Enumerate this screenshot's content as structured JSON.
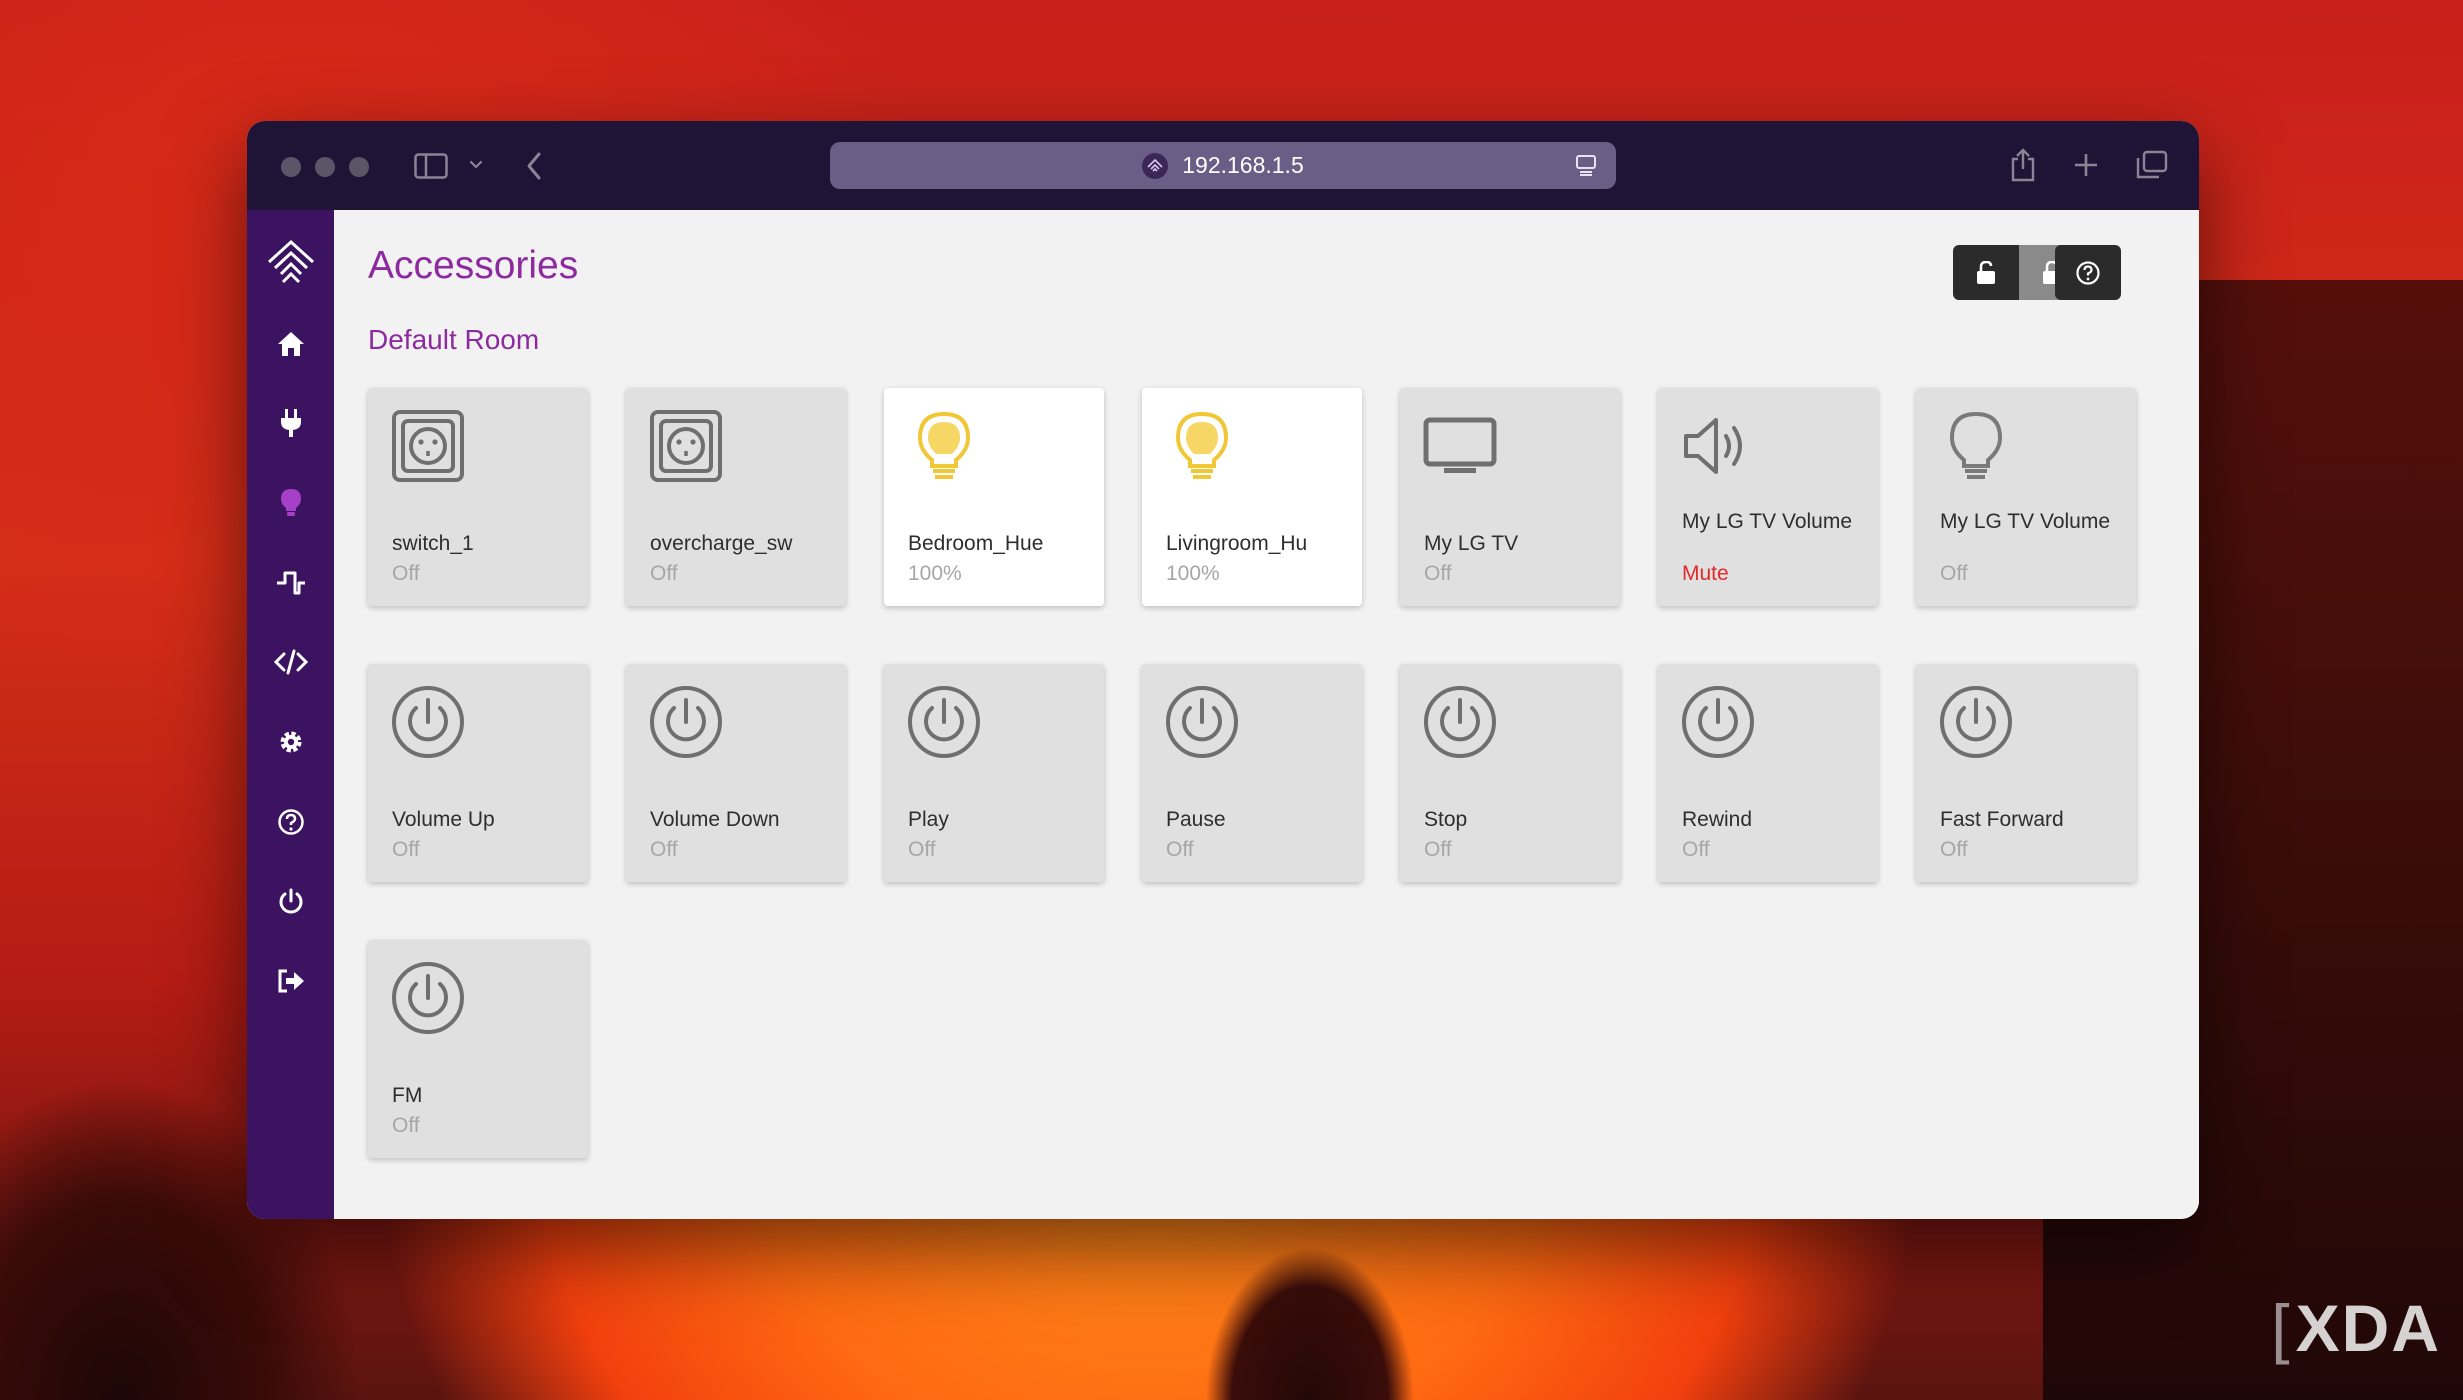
{
  "browser": {
    "url": "192.168.1.5"
  },
  "sidebar": {
    "items": [
      {
        "icon": "homebridge-logo-icon"
      },
      {
        "icon": "home-icon"
      },
      {
        "icon": "plug-icon"
      },
      {
        "icon": "lightbulb-icon",
        "active": true
      },
      {
        "icon": "pulse-icon"
      },
      {
        "icon": "code-icon"
      },
      {
        "icon": "gear-icon"
      },
      {
        "icon": "help-icon"
      },
      {
        "icon": "power-icon"
      },
      {
        "icon": "logout-icon"
      }
    ]
  },
  "page": {
    "title": "Accessories",
    "room": "Default Room"
  },
  "accessories": [
    {
      "name": "switch_1",
      "state": "Off",
      "icon": "outlet-icon",
      "on": false
    },
    {
      "name": "overcharge_sw",
      "state": "Off",
      "icon": "outlet-icon",
      "on": false
    },
    {
      "name": "Bedroom_Hue",
      "state": "100%",
      "icon": "lightbulb-icon",
      "on": true
    },
    {
      "name": "Livingroom_Hu",
      "state": "100%",
      "icon": "lightbulb-icon",
      "on": true
    },
    {
      "name": "My LG TV",
      "state": "Off",
      "icon": "tv-icon",
      "on": false
    },
    {
      "name": "My LG TV Volume",
      "state": "Mute",
      "icon": "speaker-icon",
      "on": false
    },
    {
      "name": "My LG TV Volume",
      "state": "Off",
      "icon": "lightbulb-icon",
      "on": false
    },
    {
      "name": "Volume Up",
      "state": "Off",
      "icon": "power-icon",
      "on": false
    },
    {
      "name": "Volume Down",
      "state": "Off",
      "icon": "power-icon",
      "on": false
    },
    {
      "name": "Play",
      "state": "Off",
      "icon": "power-icon",
      "on": false
    },
    {
      "name": "Pause",
      "state": "Off",
      "icon": "power-icon",
      "on": false
    },
    {
      "name": "Stop",
      "state": "Off",
      "icon": "power-icon",
      "on": false
    },
    {
      "name": "Rewind",
      "state": "Off",
      "icon": "power-icon",
      "on": false
    },
    {
      "name": "Fast Forward",
      "state": "Off",
      "icon": "power-icon",
      "on": false
    },
    {
      "name": "FM",
      "state": "Off",
      "icon": "power-icon",
      "on": false
    }
  ],
  "colors": {
    "accent": "#8e2aa0",
    "sidebar": "#3c1361",
    "bulb_on": "#f2c736",
    "mute": "#e12a2a"
  },
  "watermark": "XDA"
}
